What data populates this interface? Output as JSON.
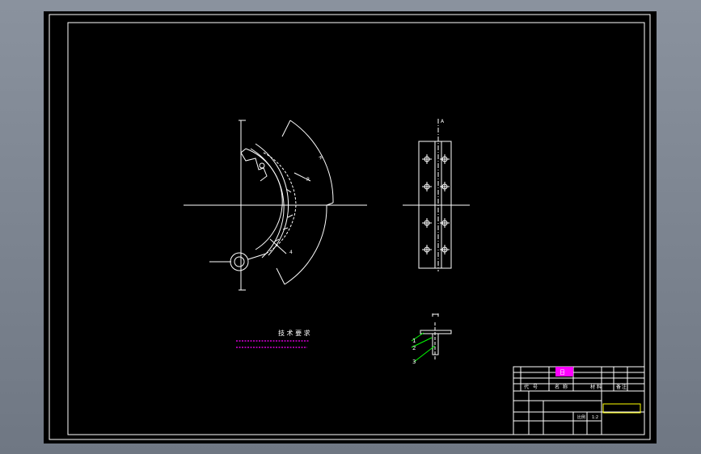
{
  "drawing": {
    "colors": {
      "background": "#000000",
      "line": "#ffffff",
      "note": "#ff00ff",
      "leader": "#00ff00",
      "title_highlight": "#ffff00"
    },
    "tech_requirements": {
      "title": "技 术 要 求"
    },
    "part_callouts": [
      "1",
      "2",
      "3"
    ],
    "section_marks": [
      "A",
      "A"
    ],
    "title_block": {
      "stamp": "日",
      "cells": [
        "代",
        "号",
        "名",
        "称",
        "材",
        "料",
        "备",
        "注"
      ],
      "scale": "比例",
      "sheet": "1:2"
    }
  }
}
